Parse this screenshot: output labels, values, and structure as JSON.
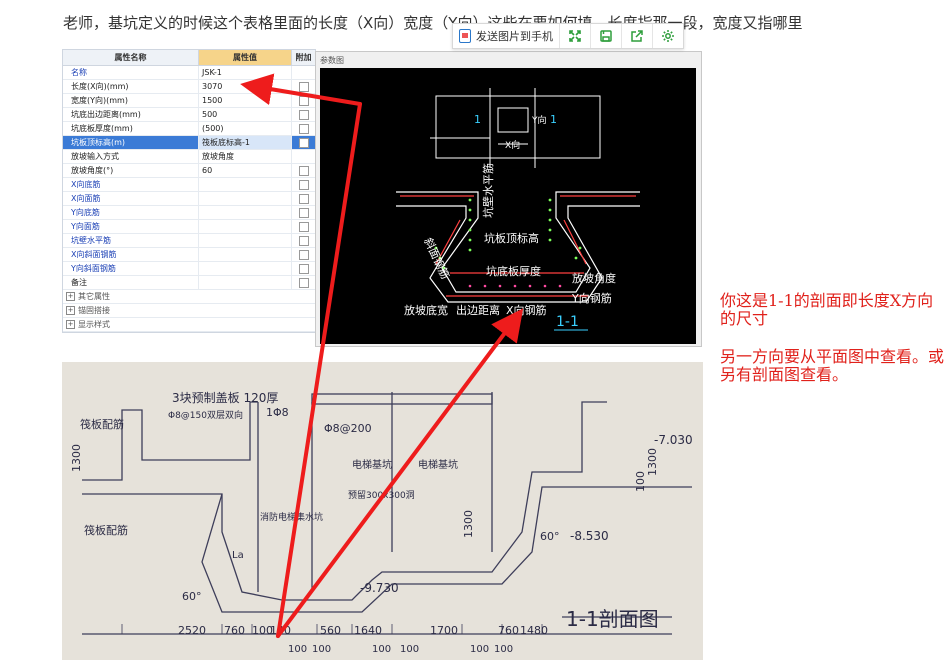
{
  "question": "老师，基坑定义的时候这个表格里面的长度（X向）宽度（Y向）这些在要如何填，长度指那一段，宽度又指哪里",
  "properties": {
    "headers": {
      "name": "属性名称",
      "value": "属性值",
      "add": "附加"
    },
    "rows": [
      {
        "name": "名称",
        "value": "JSK-1",
        "blue": true,
        "selected": false,
        "check": false
      },
      {
        "name": "长度(X向)(mm)",
        "value": "3070",
        "blue": false,
        "selected": false,
        "check": true
      },
      {
        "name": "宽度(Y向)(mm)",
        "value": "1500",
        "blue": false,
        "selected": false,
        "check": true
      },
      {
        "name": "坑底出边距离(mm)",
        "value": "500",
        "blue": false,
        "selected": false,
        "check": true
      },
      {
        "name": "坑底板厚度(mm)",
        "value": "(500)",
        "blue": false,
        "selected": false,
        "check": true
      },
      {
        "name": "坑板顶标高(m)",
        "value": "筏板底标高-1",
        "blue": false,
        "selected": true,
        "check": true
      },
      {
        "name": "放坡输入方式",
        "value": "放坡角度",
        "blue": false,
        "selected": false,
        "check": false
      },
      {
        "name": "放坡角度(°)",
        "value": "60",
        "blue": false,
        "selected": false,
        "check": true
      },
      {
        "name": "X向底筋",
        "value": "",
        "blue": true,
        "selected": false,
        "check": true
      },
      {
        "name": "X向面筋",
        "value": "",
        "blue": true,
        "selected": false,
        "check": true
      },
      {
        "name": "Y向底筋",
        "value": "",
        "blue": true,
        "selected": false,
        "check": true
      },
      {
        "name": "Y向面筋",
        "value": "",
        "blue": true,
        "selected": false,
        "check": true
      },
      {
        "name": "坑壁水平筋",
        "value": "",
        "blue": true,
        "selected": false,
        "check": true
      },
      {
        "name": "X向斜面钢筋",
        "value": "",
        "blue": true,
        "selected": false,
        "check": true
      },
      {
        "name": "Y向斜面钢筋",
        "value": "",
        "blue": true,
        "selected": false,
        "check": true
      },
      {
        "name": "备注",
        "value": "",
        "blue": false,
        "selected": false,
        "check": true
      }
    ],
    "groups": [
      "其它属性",
      "锚固搭接",
      "显示样式"
    ]
  },
  "param": {
    "title": "参数图",
    "plan_label_left": "1",
    "plan_label_right": "1",
    "plan_y": "Y向",
    "plan_x": "X向",
    "sec_wall": "坑壁水平筋",
    "sec_top": "坑板顶标高",
    "sec_slope_rebar": "斜面钢筋",
    "sec_thick": "坑底板厚度",
    "sec_angle": "放坡角度",
    "sec_y_rebar": "Y向钢筋",
    "sec_slope_width": "放坡底宽",
    "sec_edge": "出边距离",
    "sec_x_rebar": "X向钢筋",
    "sec_title": "1-1"
  },
  "toolbar": {
    "send": "发送图片到手机",
    "buttons": [
      "expand-icon",
      "save-icon",
      "share-icon",
      "settings-icon"
    ]
  },
  "drawing": {
    "pile_top": "筏板配筋",
    "pile_bottom": "筏板配筋",
    "precast": "3块预制盖板 120厚",
    "rebar1": "Φ8@150双层双向",
    "rebar2": "1Φ8",
    "rebar3": "Φ8@200",
    "pit1": "电梯基坑",
    "pit2": "电梯基坑",
    "opening": "预留300x300洞",
    "fire": "消防电梯集水坑",
    "el1": "-7.030",
    "el2": "-8.530",
    "el3": "-9.730",
    "dim_left": "1300",
    "dim_mid": "1300",
    "dim_right": "100",
    "dim_right2": "1300",
    "deg1": "60°",
    "deg2": "60°",
    "la": "La",
    "title": "1-1剖面图",
    "dims": [
      "2520",
      "760",
      "100",
      "140",
      "560",
      "1640",
      "1700",
      "760",
      "1480"
    ],
    "dims_small": [
      "100",
      "100",
      "100",
      "100",
      "100",
      "100"
    ]
  },
  "answer": {
    "p1": "你这是1-1的剖面即长度X方向的尺寸",
    "p2": "另一方向要从平面图中查看。或另有剖面图查看。"
  },
  "colors": {
    "arrow": "#ee1c1c",
    "answer": "#e0211b",
    "selected_row": "#3b7bd6",
    "value_header": "#f6d48a"
  }
}
